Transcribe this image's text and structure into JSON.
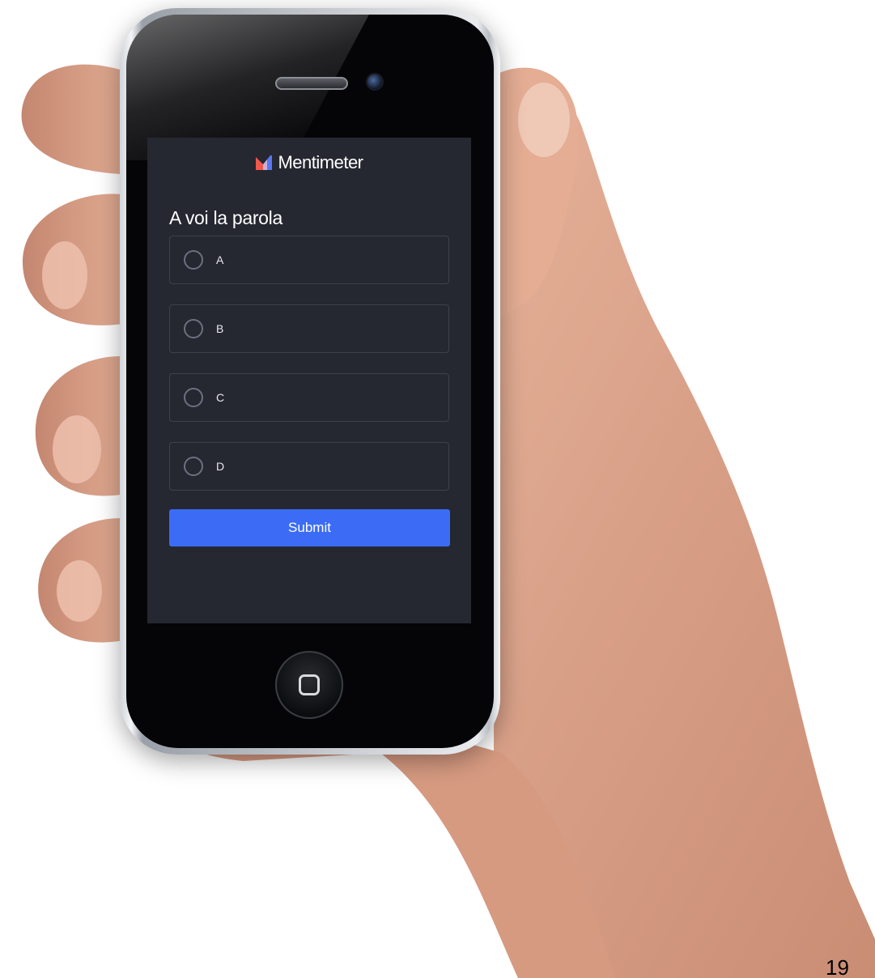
{
  "screen": {
    "brand_name": "Mentimeter",
    "question": "A voi la parola",
    "options": [
      {
        "label": "A"
      },
      {
        "label": "B"
      },
      {
        "label": "C"
      },
      {
        "label": "D"
      }
    ],
    "submit_label": "Submit"
  },
  "page_number": "19",
  "colors": {
    "screen_background": "#252731",
    "option_border": "#3e414d",
    "submit_button": "#3c6cf5",
    "logo_red": "#f0584d",
    "logo_blue": "#5b78f2"
  }
}
